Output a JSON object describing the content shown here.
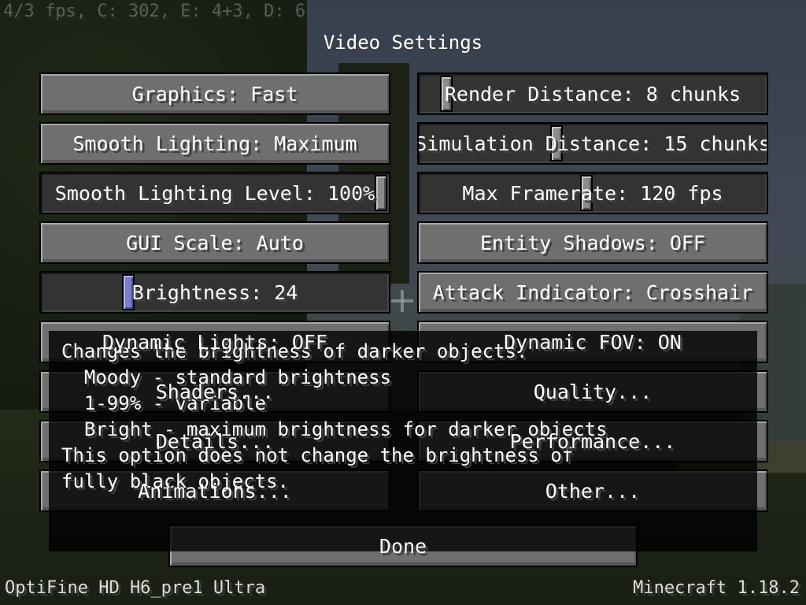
{
  "debug_overlay": "4/3 fps, C: 302, E: 4+3, D: 6",
  "title": "Video Settings",
  "left_column": [
    {
      "label": "Graphics: Fast",
      "type": "button"
    },
    {
      "label": "Smooth Lighting: Maximum",
      "type": "button"
    },
    {
      "label": "Smooth Lighting Level: 100%",
      "type": "slider",
      "value": 1.0
    },
    {
      "label": "GUI Scale: Auto",
      "type": "button"
    },
    {
      "label": "Brightness: 24",
      "type": "slider",
      "value": 0.24
    },
    {
      "label": "Dynamic Lights: OFF",
      "type": "button"
    },
    {
      "label": "Shaders...",
      "type": "button"
    },
    {
      "label": "Details...",
      "type": "button"
    },
    {
      "label": "Animations...",
      "type": "button"
    }
  ],
  "right_column": [
    {
      "label": "Render Distance: 8 chunks",
      "type": "slider",
      "value": 0.06
    },
    {
      "label": "Simulation Distance: 15 chunks",
      "type": "slider",
      "value": 0.39
    },
    {
      "label": "Max Framerate: 120 fps",
      "type": "slider",
      "value": 0.48
    },
    {
      "label": "Entity Shadows: OFF",
      "type": "button"
    },
    {
      "label": "Attack Indicator: Crosshair",
      "type": "button"
    },
    {
      "label": "Dynamic FOV: ON",
      "type": "button"
    },
    {
      "label": "Quality...",
      "type": "button"
    },
    {
      "label": "Performance...",
      "type": "button"
    },
    {
      "label": "Other...",
      "type": "button"
    }
  ],
  "done_button": "Done",
  "tooltip": [
    "Changes the brightness of darker objects.",
    "  Moody - standard brightness",
    "  1-99% - variable",
    "  Bright - maximum brightness for darker objects",
    "This option does not change the brightness of",
    "fully black objects."
  ],
  "footer": {
    "left": "OptiFine HD H6_pre1 Ultra",
    "right": "Minecraft 1.18.2"
  },
  "colors": {
    "slider_knob_active": "#7a7ec8"
  }
}
